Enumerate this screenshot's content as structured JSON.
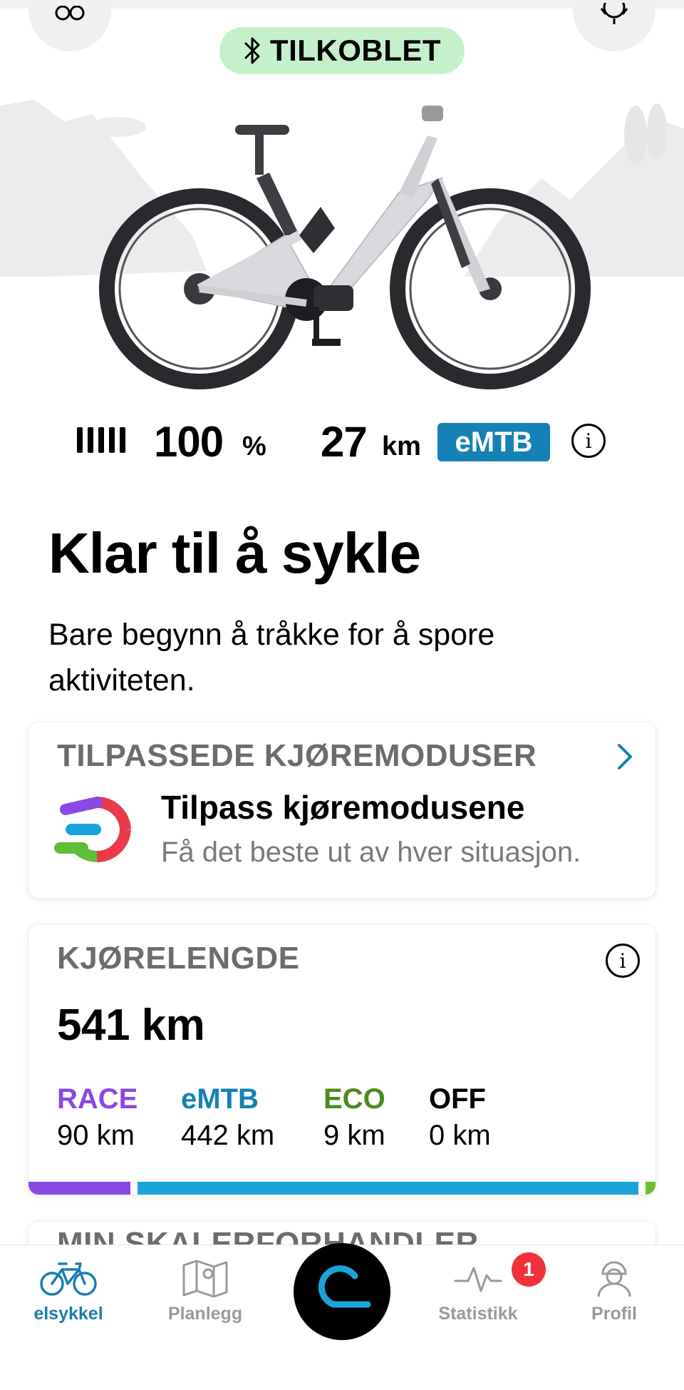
{
  "status": {
    "connection_label": "TILKOBLET"
  },
  "bike": {
    "battery_percent_value": "100",
    "battery_percent_unit": "%",
    "battery_level": 1.0,
    "range_value": "27",
    "range_unit": "km",
    "assist_mode": "eMTB"
  },
  "main": {
    "headline": "Klar til å sykle",
    "subtext": "Bare begynn å tråkke for å spore aktiviteten."
  },
  "custom_modes_card": {
    "title": "TILPASSEDE KJØREMODUSER",
    "heading": "Tilpass kjøremodusene",
    "subheading": "Få det beste ut av hver situasjon."
  },
  "odometer_card": {
    "title": "KJØRELENGDE",
    "total": "541 km",
    "segments": [
      {
        "label": "RACE",
        "value": "90 km",
        "km": 90,
        "color": "#8a48e6"
      },
      {
        "label": "eMTB",
        "value": "442 km",
        "km": 442,
        "color": "#1aa3db"
      },
      {
        "label": "ECO",
        "value": "9 km",
        "km": 9,
        "color": "#6fbf2a"
      },
      {
        "label": "OFF",
        "value": "0 km",
        "km": 0,
        "color": "#000000"
      }
    ]
  },
  "next_card": {
    "title": "MIN SKALERFORHANDLER"
  },
  "tabbar": {
    "tabs": [
      {
        "label": "elsykkel",
        "icon": "bike-icon",
        "active": true
      },
      {
        "label": "Planlegg",
        "icon": "map-icon",
        "active": false
      },
      {
        "label": "",
        "icon": "ride-start-icon",
        "active": false
      },
      {
        "label": "Statistikk",
        "icon": "activity-icon",
        "active": false,
        "badge": "1"
      },
      {
        "label": "Profil",
        "icon": "profile-icon",
        "active": false
      }
    ]
  },
  "colors": {
    "accent": "#1581b4",
    "connected_bg": "#c6f0cc",
    "badge_red": "#f0313a"
  }
}
